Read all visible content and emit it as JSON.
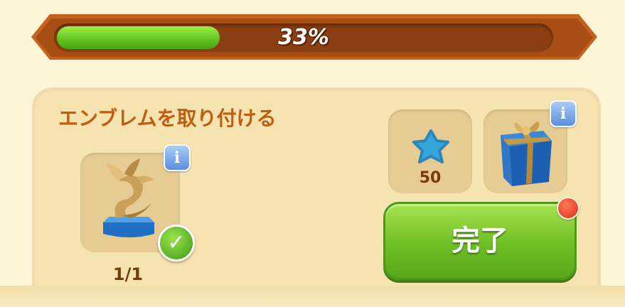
{
  "progress": {
    "percent_text": "33%",
    "fraction": 0.33
  },
  "task": {
    "title": "エンブレムを取り付ける",
    "item_count": "1/1"
  },
  "rewards": {
    "star_count": "50"
  },
  "complete_button": {
    "label": "完了"
  },
  "info_label": "i",
  "colors": {
    "progress_fill": "#5fc11c",
    "progress_frame": "#c4621e",
    "panel_bg": "#f5e3b0",
    "title_text": "#c05d10",
    "button_green": "#6fbe25",
    "notification_red": "#e02c10"
  }
}
